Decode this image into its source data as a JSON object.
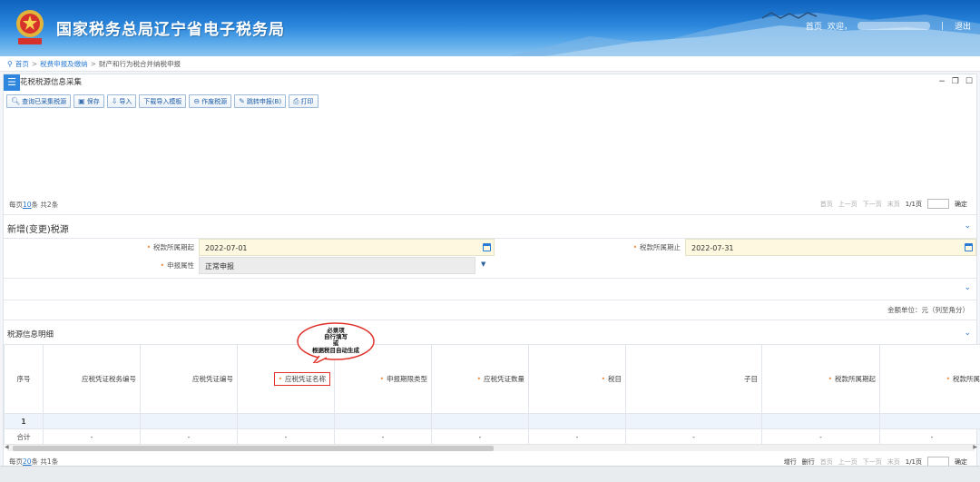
{
  "header": {
    "site_title": "国家税务总局辽宁省电子税务局",
    "nav_home": "首页",
    "nav_welcome": "欢迎，",
    "nav_sep": "|",
    "nav_logout": "退出"
  },
  "breadcrumb": {
    "items": [
      "首页",
      "税费申报及缴纳",
      "财产和行为税合并纳税申报"
    ],
    "sep": ">"
  },
  "panel": {
    "title": "花税税源信息采集",
    "toolbar": [
      {
        "label": "查询已采集税源",
        "icon": "search-icon"
      },
      {
        "label": "保存",
        "icon": "save-icon"
      },
      {
        "label": "导入",
        "icon": "import-icon"
      },
      {
        "label": "下载导入模板",
        "icon": ""
      },
      {
        "label": "作废税源",
        "icon": "void-icon"
      },
      {
        "label": "跳转申报(B)",
        "icon": "jump-icon"
      },
      {
        "label": "打印",
        "icon": "print-icon"
      }
    ]
  },
  "pager_top": {
    "prefix": "每页",
    "size": "10",
    "suffix": "条 共2条",
    "first": "首页",
    "prev": "上一页",
    "next": "下一页",
    "last": "末页",
    "pages": "1/1页",
    "confirm": "确定"
  },
  "new_source": {
    "title": "新增(变更)税源",
    "period_start_label": "税款所属期起",
    "period_start_value": "2022-07-01",
    "period_end_label": "税款所属期止",
    "period_end_value": "2022-07-31",
    "declare_attr_label": "申报属性",
    "declare_attr_value": "正常申报"
  },
  "unit_note": "金额单位：元（列至角分）",
  "detail": {
    "title": "税源信息明细",
    "columns": [
      {
        "label": "序号",
        "required": false
      },
      {
        "label": "应税凭证税务编号",
        "required": false
      },
      {
        "label": "应税凭证编号",
        "required": false
      },
      {
        "label": "应税凭证名称",
        "required": true
      },
      {
        "label": "申报期限类型",
        "required": true
      },
      {
        "label": "应税凭证数量",
        "required": true
      },
      {
        "label": "税目",
        "required": true
      },
      {
        "label": "子目",
        "required": false
      },
      {
        "label": "税款所属期起",
        "required": true
      },
      {
        "label": "税款所属",
        "required": true
      }
    ],
    "rows": [
      [
        "1",
        "",
        "",
        "",
        "",
        "",
        "",
        "",
        "",
        ""
      ],
      [
        "合计",
        "-",
        "-",
        "-",
        "-",
        "-",
        "-",
        "-",
        "-",
        "-"
      ]
    ]
  },
  "pager_bottom": {
    "prefix": "每页",
    "size": "20",
    "suffix": "条 共1条",
    "add_row": "增行",
    "del_row": "删行",
    "first": "首页",
    "prev": "上一页",
    "next": "下一页",
    "last": "末页",
    "pages": "1/1页",
    "confirm": "确定"
  },
  "callout": {
    "line1": "必录项",
    "line2": "自行填写",
    "line3": "或",
    "line4": "根据税目自动生成"
  },
  "colors": {
    "brand_blue": "#2a7ad3",
    "required_marker": "#f08a3c",
    "highlight_red": "#e0322a"
  }
}
